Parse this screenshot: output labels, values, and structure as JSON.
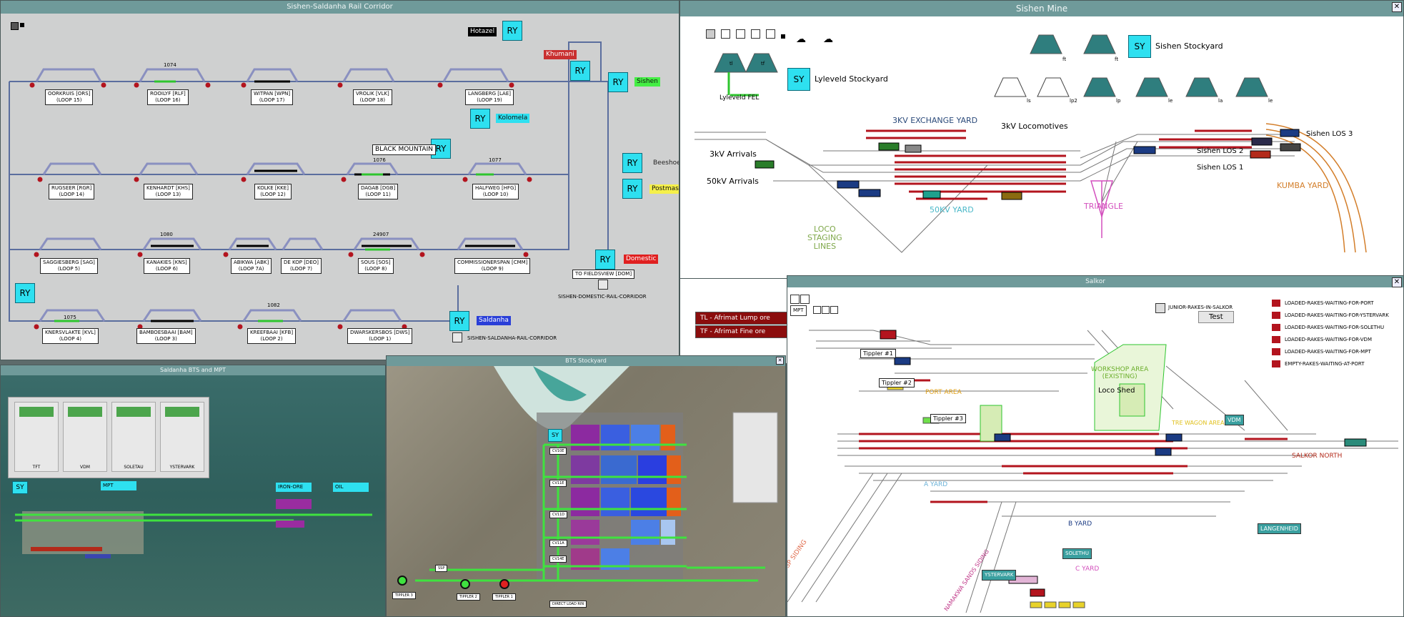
{
  "rail": {
    "title": "Sishen-Saldanha Rail Corridor",
    "loops": [
      {
        "name": "OORKRUIS [ORS]",
        "loop": "(LOOP 15)"
      },
      {
        "name": "ROOILYF [RLF]",
        "loop": "(LOOP 16)"
      },
      {
        "name": "WITPAN [WPN]",
        "loop": "(LOOP 17)"
      },
      {
        "name": "VROLIK [VLK]",
        "loop": "(LOOP 18)"
      },
      {
        "name": "LANGBERG [LAE]",
        "loop": "(LOOP 19)"
      },
      {
        "name": "RUGSEER [RGR]",
        "loop": "(LOOP 14)"
      },
      {
        "name": "KENHARDT [KHS]",
        "loop": "(LOOP 13)"
      },
      {
        "name": "KOLKE [KKE]",
        "loop": "(LOOP 12)"
      },
      {
        "name": "DAGAB [DGB]",
        "loop": "(LOOP 11)"
      },
      {
        "name": "HALFWEG [HFG]",
        "loop": "(LOOP 10)"
      },
      {
        "name": "SAGGIESBERG [SAG]",
        "loop": "(LOOP 5)"
      },
      {
        "name": "KANAKIES [KNS]",
        "loop": "(LOOP 6)"
      },
      {
        "name": "ABIKWA [ABK]",
        "loop": "(LOOP 7A)"
      },
      {
        "name": "DE KOP [DEO]",
        "loop": "(LOOP 7)"
      },
      {
        "name": "SOUS [SOS]",
        "loop": "(LOOP 8)"
      },
      {
        "name": "COMMISSIONERSPAN [CMM]",
        "loop": "(LOOP 9)"
      },
      {
        "name": "KNERSVLAKTE [KVL]",
        "loop": "(LOOP 4)"
      },
      {
        "name": "BAMBOESBAAI [BAM]",
        "loop": "(LOOP 3)"
      },
      {
        "name": "KREEFBAAI [KFB]",
        "loop": "(LOOP 2)"
      },
      {
        "name": "DWARSKERSBOS [DWS]",
        "loop": "(LOOP 1)"
      }
    ],
    "trains": [
      "1074",
      "1076",
      "1077",
      "1080",
      "24907",
      "1075",
      "1082"
    ],
    "ry": "RY",
    "places": {
      "hotazel": "Hotazel",
      "khumani": "Khumani",
      "sishen": "Sishen",
      "kolomela": "Kolomela",
      "black_mountain": "BLACK MOUNTAIN",
      "beeshoek": "Beeshoek",
      "postmasburg": "Postmasburg",
      "domestic": "Domestic",
      "saldanha": "Saldanha"
    },
    "to_fieldsview": "TO FIELDSVIEW [DOM]",
    "domestic_corridor": "SISHEN-DOMESTIC-RAIL-CORRIDOR",
    "saldanha_corridor": "SISHEN-SALDANHA-RAIL-CORRIDOR"
  },
  "mine": {
    "title": "Sishen Mine",
    "sy": "SY",
    "lyleveld_stockyard": "Lyleveld Stockyard",
    "sishen_stockyard": "Sishen Stockyard",
    "lyleveld_fel": "Lyleveld FEL",
    "arrivals_3kv": "3kV Arrivals",
    "arrivals_50kv": "50kV Arrivals",
    "exchange_yard": "3KV EXCHANGE YARD",
    "locomotives_3kv": "3kV Locomotives",
    "yard_50kv": "50KV YARD",
    "triangle": "TRIANGLE",
    "loco_staging": [
      "LOCO",
      "STAGING",
      "LINES"
    ],
    "kumba_yard": "KUMBA YARD",
    "sishen_los_1": "Sishen LOS 1",
    "sishen_los_2": "Sishen LOS 2",
    "sishen_los_3": "Sishen LOS 3",
    "pile_labels": [
      "tl",
      "tf",
      "ft",
      "ft",
      "ls",
      "lp2",
      "lp",
      "le",
      "la",
      "le"
    ],
    "legend": [
      {
        "code": "TL",
        "text": "TL - Afrimat Lump ore"
      },
      {
        "code": "TF",
        "text": "TF - Afrimat Fine ore"
      }
    ]
  },
  "saldanha": {
    "title": "Saldanha BTS and MPT",
    "sy": "SY",
    "mpt": "MPT",
    "iron_ore": "IRON-ORE",
    "oil": "OIL",
    "panels": [
      "TFT",
      "VDM",
      "SOLETAU",
      "YSTERVARK"
    ]
  },
  "bts": {
    "title": "BTS Stockyard",
    "sy": "SY",
    "conveyors": [
      "CV10E",
      "CV11E",
      "CV11D",
      "CV11A",
      "CV14E"
    ],
    "tipplers": [
      "TIPPLER 3",
      "TIPPLER 2",
      "TIPPLER 1"
    ],
    "direct_load": "DIRECT LOAD RIN",
    "ssp": "SSP"
  },
  "salkor": {
    "title": "Salkor",
    "junior_rakes": "JUNIOR-RAKES-IN-SALKOR",
    "test_button": "Test",
    "legend": [
      "LOADED-RAKES-WAITING-FOR-PORT",
      "LOADED-RAKES-WAITING-FOR-YSTERVARK",
      "LOADED-RAKES-WAITING-FOR-SOLETHU",
      "LOADED-RAKES-WAITING-FOR-VDM",
      "LOADED-RAKES-WAITING-FOR-MPT",
      "EMPTY-RAKES-WAITING-AT-PORT"
    ],
    "tippler_1": "Tippler #1",
    "tippler_2": "Tippler #2",
    "tippler_3": "Tippler #3",
    "port_area": "PORT AREA",
    "workshop": [
      "WORKSHOP AREA",
      "(EXISTING)"
    ],
    "loco_shed": "Loco Shed",
    "tre_wagon": "TRE WAGON AREA",
    "vdm": "VDM",
    "salkor_north": "SALKOR NORTH",
    "langenheid": "LANGENHEID",
    "a_yard": "A YARD",
    "b_yard": "B YARD",
    "c_yard": "C YARD",
    "solethu": "SOLETHU",
    "ystervark": "YSTERVARK",
    "ssp_siding": "SSP SIDING",
    "namakwa_sands": "NAMAKWA SANDS SIDING",
    "mpt": "MPT"
  }
}
